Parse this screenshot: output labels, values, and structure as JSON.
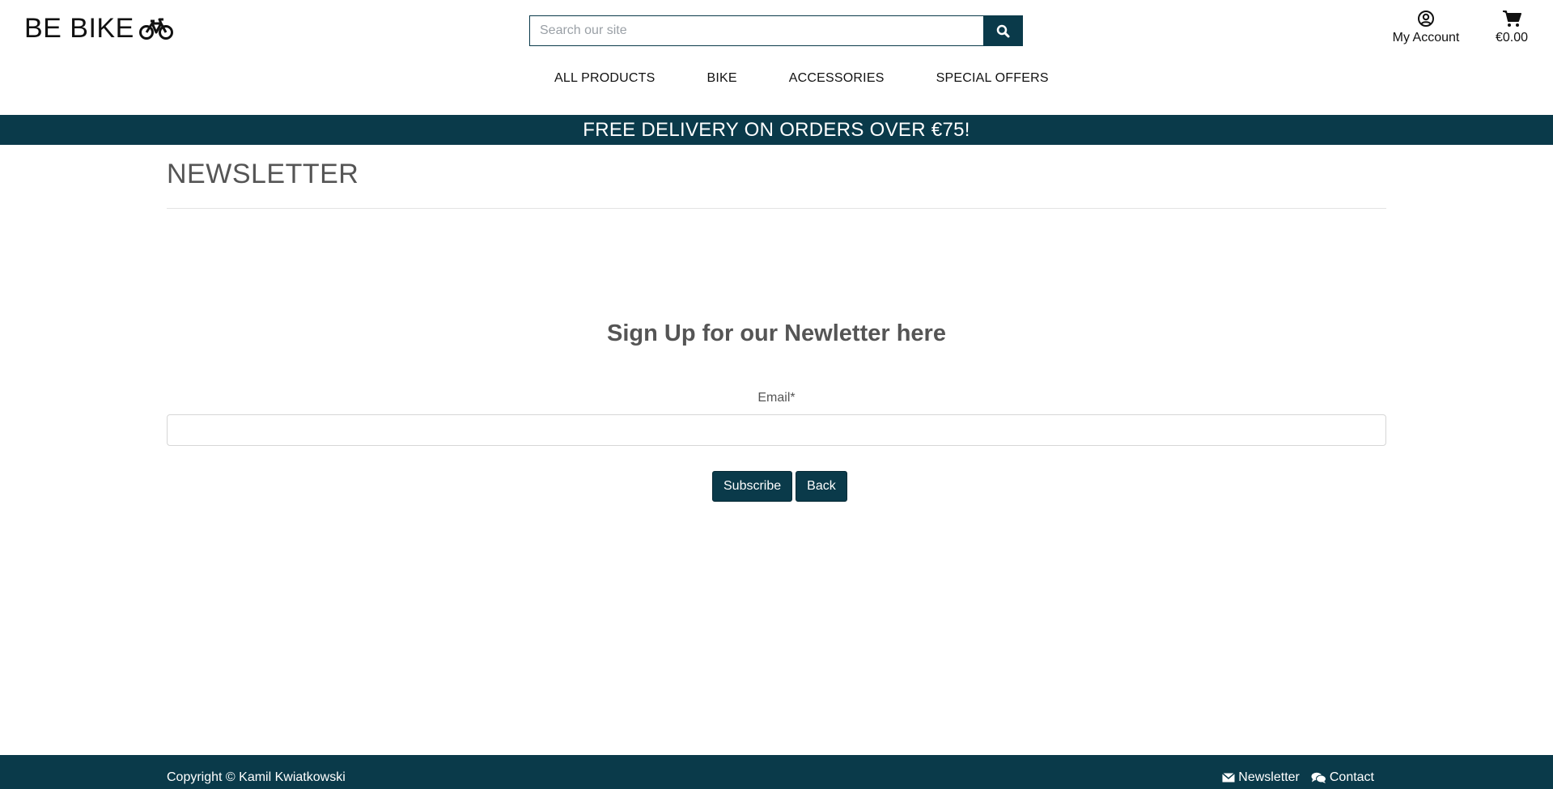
{
  "header": {
    "logo_text": "BE BIKE",
    "logo_icon": "bicycle-icon",
    "search": {
      "placeholder": "Search our site",
      "icon": "search-icon"
    },
    "account": {
      "label": "My Account",
      "icon": "user-circle-icon"
    },
    "cart": {
      "amount": "€0.00",
      "icon": "shopping-cart-icon"
    }
  },
  "nav": {
    "items": [
      {
        "label": "ALL PRODUCTS"
      },
      {
        "label": "BIKE"
      },
      {
        "label": "ACCESSORIES"
      },
      {
        "label": "SPECIAL OFFERS"
      }
    ]
  },
  "banner": {
    "text": "FREE DELIVERY ON ORDERS OVER €75!"
  },
  "main": {
    "page_title": "NEWSLETTER",
    "heading": "Sign Up for our Newletter here",
    "email_label": "Email*",
    "subscribe_label": "Subscribe",
    "back_label": "Back"
  },
  "footer": {
    "copyright": "Copyright © Kamil Kwiatkowski",
    "newsletter_label": "Newsletter",
    "contact_label": "Contact"
  },
  "colors": {
    "brand": "#0a3a4a",
    "text_muted": "#555555"
  }
}
